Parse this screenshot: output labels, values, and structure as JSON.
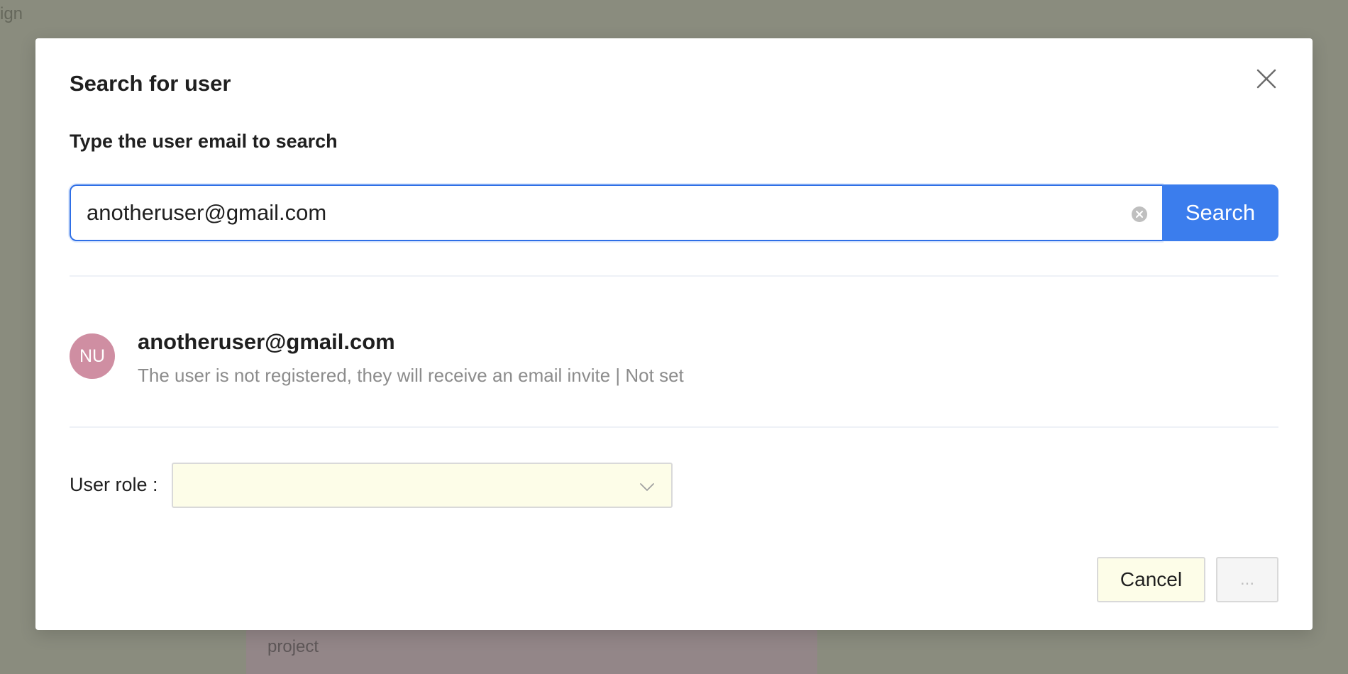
{
  "background": {
    "corner_text": "ign",
    "card_text": "project"
  },
  "modal": {
    "title": "Search for user",
    "section_label": "Type the user email to search",
    "search": {
      "value": "anotheruser@gmail.com",
      "button_label": "Search"
    },
    "result": {
      "avatar_initials": "NU",
      "email": "anotheruser@gmail.com",
      "description": "The user is not registered, they will receive an email invite | Not set"
    },
    "role": {
      "label": "User role :",
      "selected": ""
    },
    "footer": {
      "cancel_label": "Cancel",
      "ok_label": "..."
    }
  },
  "colors": {
    "primary": "#3b7ded",
    "avatar": "#cf8ea2",
    "overlay": "#8a8c7e",
    "select_bg": "#fdfde8"
  },
  "icons": {
    "close": "close-icon",
    "clear": "clear-circle-icon",
    "chevron": "chevron-down-icon"
  }
}
